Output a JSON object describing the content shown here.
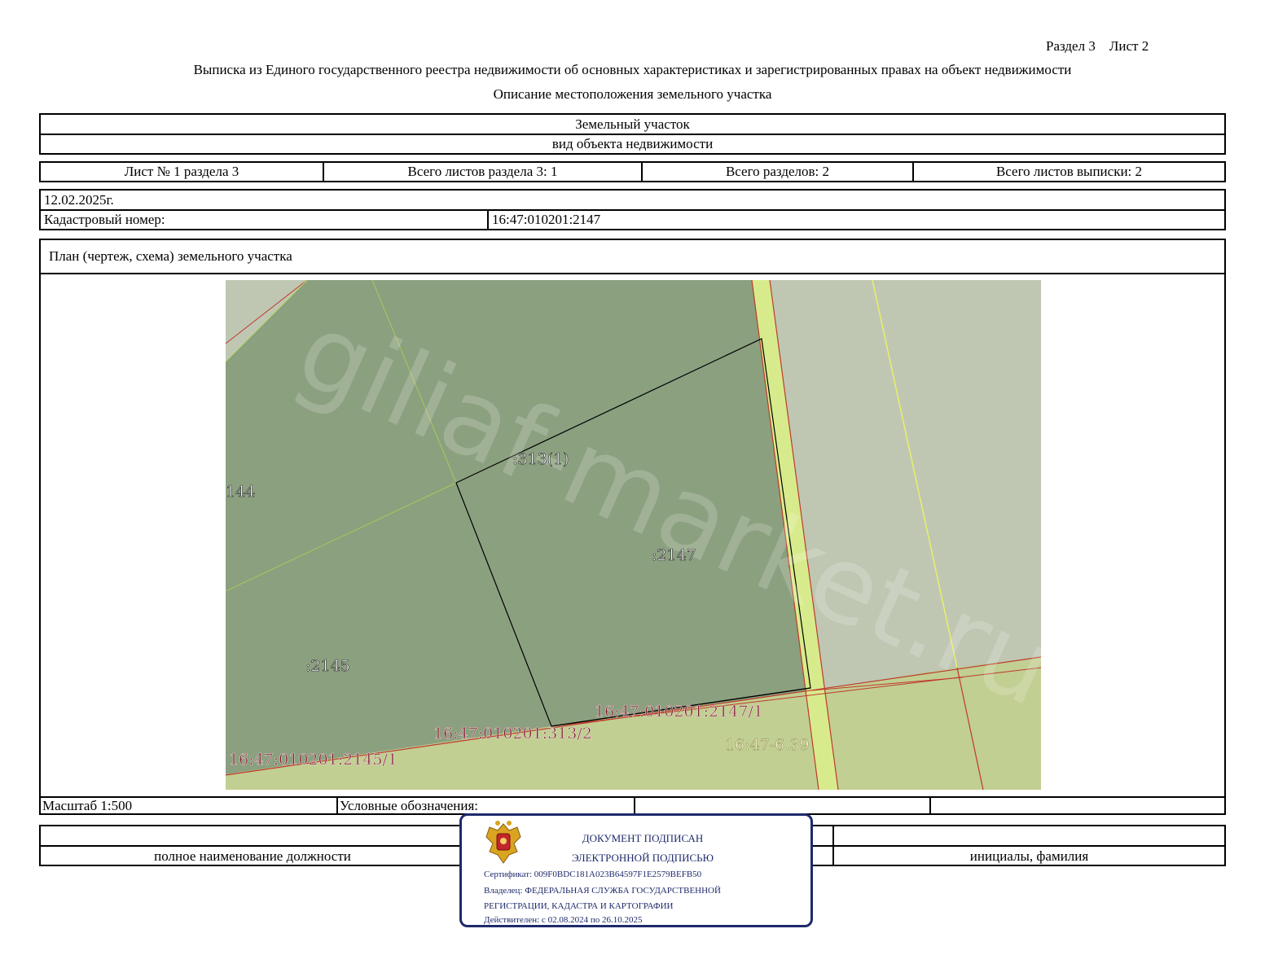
{
  "header": {
    "section_sheet": "Раздел 3    Лист 2",
    "title": "Выписка из Единого государственного реестра недвижимости об основных характеристиках и зарегистрированных правах на объект недвижимости",
    "subtitle": "Описание местоположения земельного участка"
  },
  "object": {
    "type_value": "Земельный участок",
    "type_caption": "вид объекта недвижимости"
  },
  "sheets": {
    "sheet_no": "Лист № 1 раздела 3",
    "total_sheets_section": "Всего листов раздела 3: 1",
    "total_sections": "Всего разделов: 2",
    "total_sheets_extract": "Всего листов выписки: 2"
  },
  "info": {
    "date": "12.02.2025г.",
    "cadastral_label": "Кадастровый номер:",
    "cadastral_value": "16:47:010201:2147"
  },
  "plan": {
    "heading": "План (чертеж, схема) земельного участка",
    "watermark": "giliaf-market.ru",
    "labels": {
      "parcel_313": ":313(1)",
      "parcel_144": "144",
      "parcel_2147": ":2147",
      "parcel_2145": ":2145",
      "zone_2147_1": "16:47:010201:2147/1",
      "zone_313_2": "16:47:010201:313/2",
      "zone_2145_1": "16:47:010201:2145/1",
      "zone_6_39": "16:47-6.39"
    }
  },
  "footer": {
    "scale": "Масштаб 1:500",
    "legend": "Условные обозначения:",
    "position_caption": "полное наименование должности",
    "name_caption": "инициалы, фамилия"
  },
  "stamp": {
    "line1": "ДОКУМЕНТ ПОДПИСАН",
    "line2": "ЭЛЕКТРОННОЙ ПОДПИСЬЮ",
    "certificate": "Сертификат: 009F0BDC181A023B64597F1E2579BEFB50",
    "owner_1": "Владелец: ФЕДЕРАЛЬНАЯ СЛУЖБА ГОСУДАРСТВЕННОЙ",
    "owner_2": "РЕГИСТРАЦИИ, КАДАСТРА И КАРТОГРАФИИ",
    "valid": "Действителен: с 02.08.2024 по 26.10.2025"
  },
  "colors": {
    "parcel_dark": "#8ba07f",
    "parcel_light_gray": "#bfc7b3",
    "zone_light_green": "#c1cf92",
    "road_yellow_green": "#d8eb8c",
    "boundary_red": "#c0392b",
    "label_maroon": "#7a1a2a",
    "label_cream": "#f3f0c8",
    "stamp_blue": "#1f2a6b"
  }
}
